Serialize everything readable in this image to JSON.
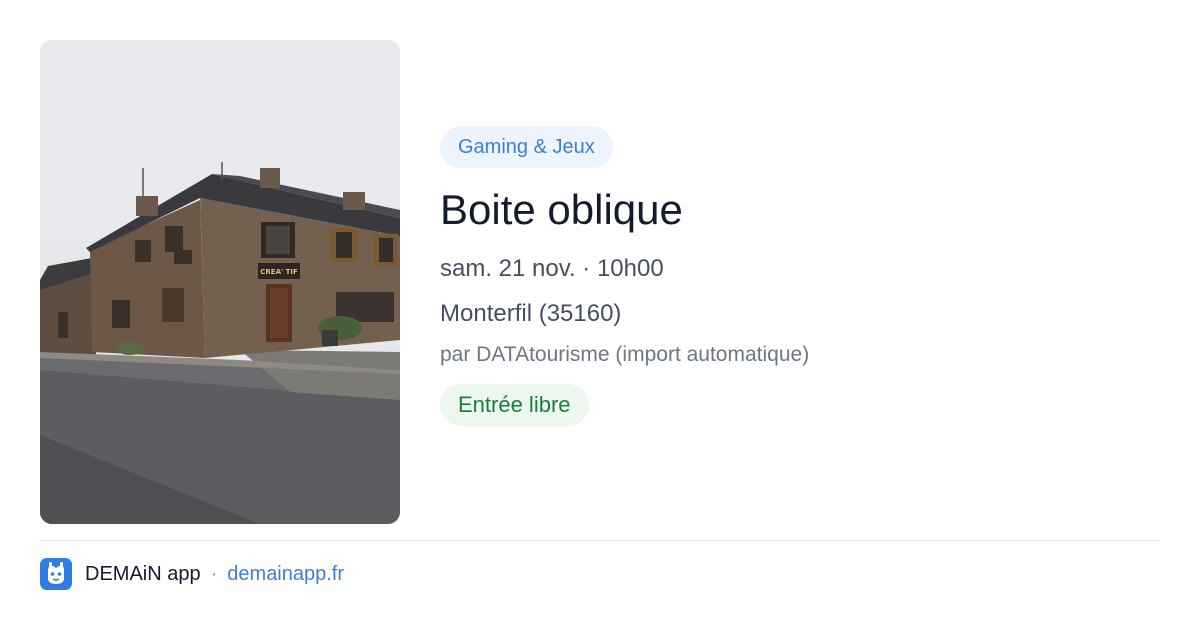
{
  "event": {
    "category": "Gaming & Jeux",
    "title": "Boite oblique",
    "date": "sam. 21 nov. · 10h00",
    "location": "Monterfil (35160)",
    "organizer": "par DATAtourisme (import automatique)",
    "price": "Entrée libre"
  },
  "photo": {
    "shop_sign": "CREA' TIF"
  },
  "footer": {
    "app_name": "DEMAiN app",
    "separator": "·",
    "url": "demainapp.fr",
    "icon": "demain-app-logo-icon"
  },
  "colors": {
    "accent_blue": "#3d7fd6",
    "pill_blue_bg": "#eef4fd",
    "pill_green_bg": "#ecf8ee",
    "pill_green_text": "#1d7d3c",
    "title_text": "#141b2d",
    "body_text": "#464f5e",
    "muted_text": "#6c7684"
  }
}
